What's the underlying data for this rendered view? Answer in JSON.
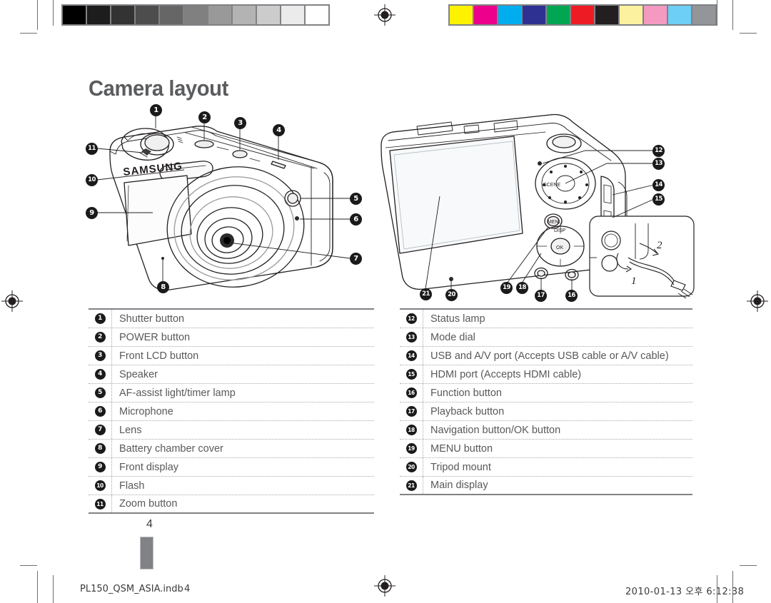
{
  "page": {
    "title": "Camera layout",
    "page_number": "4"
  },
  "footer": {
    "file_name": "PL150_QSM_ASIA.indb",
    "page_ref": "4",
    "timestamp": "2010-01-13   오후 6:12:38"
  },
  "calibration": {
    "grayscale_label": "grayscale-calibration-strip",
    "grayscale_swatches": [
      "#000000",
      "#1d1d1d",
      "#333333",
      "#4d4d4d",
      "#666666",
      "#808080",
      "#999999",
      "#b3b3b3",
      "#cccccc",
      "#ebebeb",
      "#ffffff"
    ],
    "color_label": "color-calibration-strip",
    "color_swatches": [
      "#fff200",
      "#ec008c",
      "#00aeef",
      "#2e3192",
      "#00a651",
      "#ed1c24",
      "#231f20",
      "#fbf19f",
      "#f49ac1",
      "#6dcff6",
      "#939598"
    ]
  },
  "figures": {
    "front": {
      "name": "camera-front-view",
      "brand_text": "SAMSUNG",
      "callouts": [
        "1",
        "2",
        "3",
        "4",
        "5",
        "6",
        "7",
        "8",
        "9",
        "10",
        "11"
      ]
    },
    "rear": {
      "name": "camera-rear-view",
      "callouts": [
        "12",
        "13",
        "14",
        "15",
        "16",
        "17",
        "18",
        "19",
        "20",
        "21"
      ],
      "inset": {
        "name": "cable-connection-detail",
        "step_labels": [
          "1",
          "2"
        ]
      }
    }
  },
  "legend_left": [
    {
      "num": "1",
      "label": "Shutter button"
    },
    {
      "num": "2",
      "label": "POWER button"
    },
    {
      "num": "3",
      "label": "Front LCD button"
    },
    {
      "num": "4",
      "label": "Speaker"
    },
    {
      "num": "5",
      "label": "AF-assist light/timer lamp"
    },
    {
      "num": "6",
      "label": "Microphone"
    },
    {
      "num": "7",
      "label": "Lens"
    },
    {
      "num": "8",
      "label": "Battery chamber cover"
    },
    {
      "num": "9",
      "label": "Front display"
    },
    {
      "num": "10",
      "label": "Flash"
    },
    {
      "num": "11",
      "label": "Zoom button"
    }
  ],
  "legend_right": [
    {
      "num": "12",
      "label": "Status lamp"
    },
    {
      "num": "13",
      "label": "Mode dial"
    },
    {
      "num": "14",
      "label": "USB and A/V port (Accepts USB cable or A/V cable)"
    },
    {
      "num": "15",
      "label": "HDMI port (Accepts HDMI cable)"
    },
    {
      "num": "16",
      "label": "Function button"
    },
    {
      "num": "17",
      "label": "Playback button"
    },
    {
      "num": "18",
      "label": "Navigation button/OK button"
    },
    {
      "num": "19",
      "label": "MENU button"
    },
    {
      "num": "20",
      "label": "Tripod mount"
    },
    {
      "num": "21",
      "label": "Main display"
    }
  ]
}
